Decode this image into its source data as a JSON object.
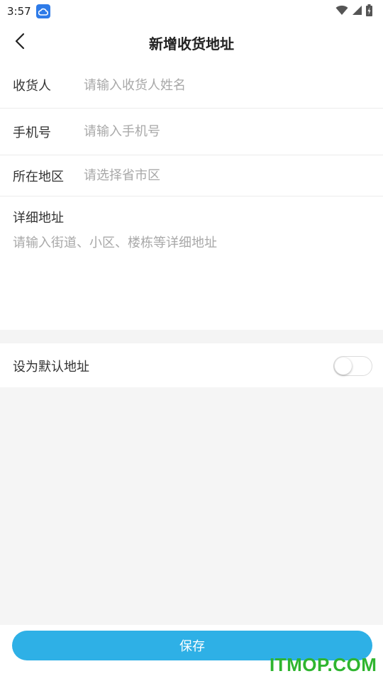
{
  "status_bar": {
    "time": "3:57",
    "icons": [
      "cloud-icon",
      "wifi-icon",
      "signal-icon",
      "battery-icon"
    ]
  },
  "header": {
    "title": "新增收货地址",
    "back_icon": "back-arrow-icon"
  },
  "form": {
    "receiver": {
      "label": "收货人",
      "value": "",
      "placeholder": "请输入收货人姓名"
    },
    "phone": {
      "label": "手机号",
      "value": "",
      "placeholder": "请输入手机号"
    },
    "region": {
      "label": "所在地区",
      "value": "",
      "placeholder": "请选择省市区"
    },
    "detail": {
      "label": "详细地址",
      "value": "",
      "placeholder": "请输入街道、小区、楼栋等详细地址"
    }
  },
  "default_address": {
    "label": "设为默认地址",
    "enabled": false
  },
  "save_button": {
    "label": "保存"
  },
  "colors": {
    "accent": "#2eb0e6",
    "placeholder": "#a8a8a8",
    "divider": "#ececec",
    "background_gray": "#f5f5f5",
    "watermark": "#2fb52f"
  },
  "watermark": {
    "text": "ITMOP.COM"
  }
}
